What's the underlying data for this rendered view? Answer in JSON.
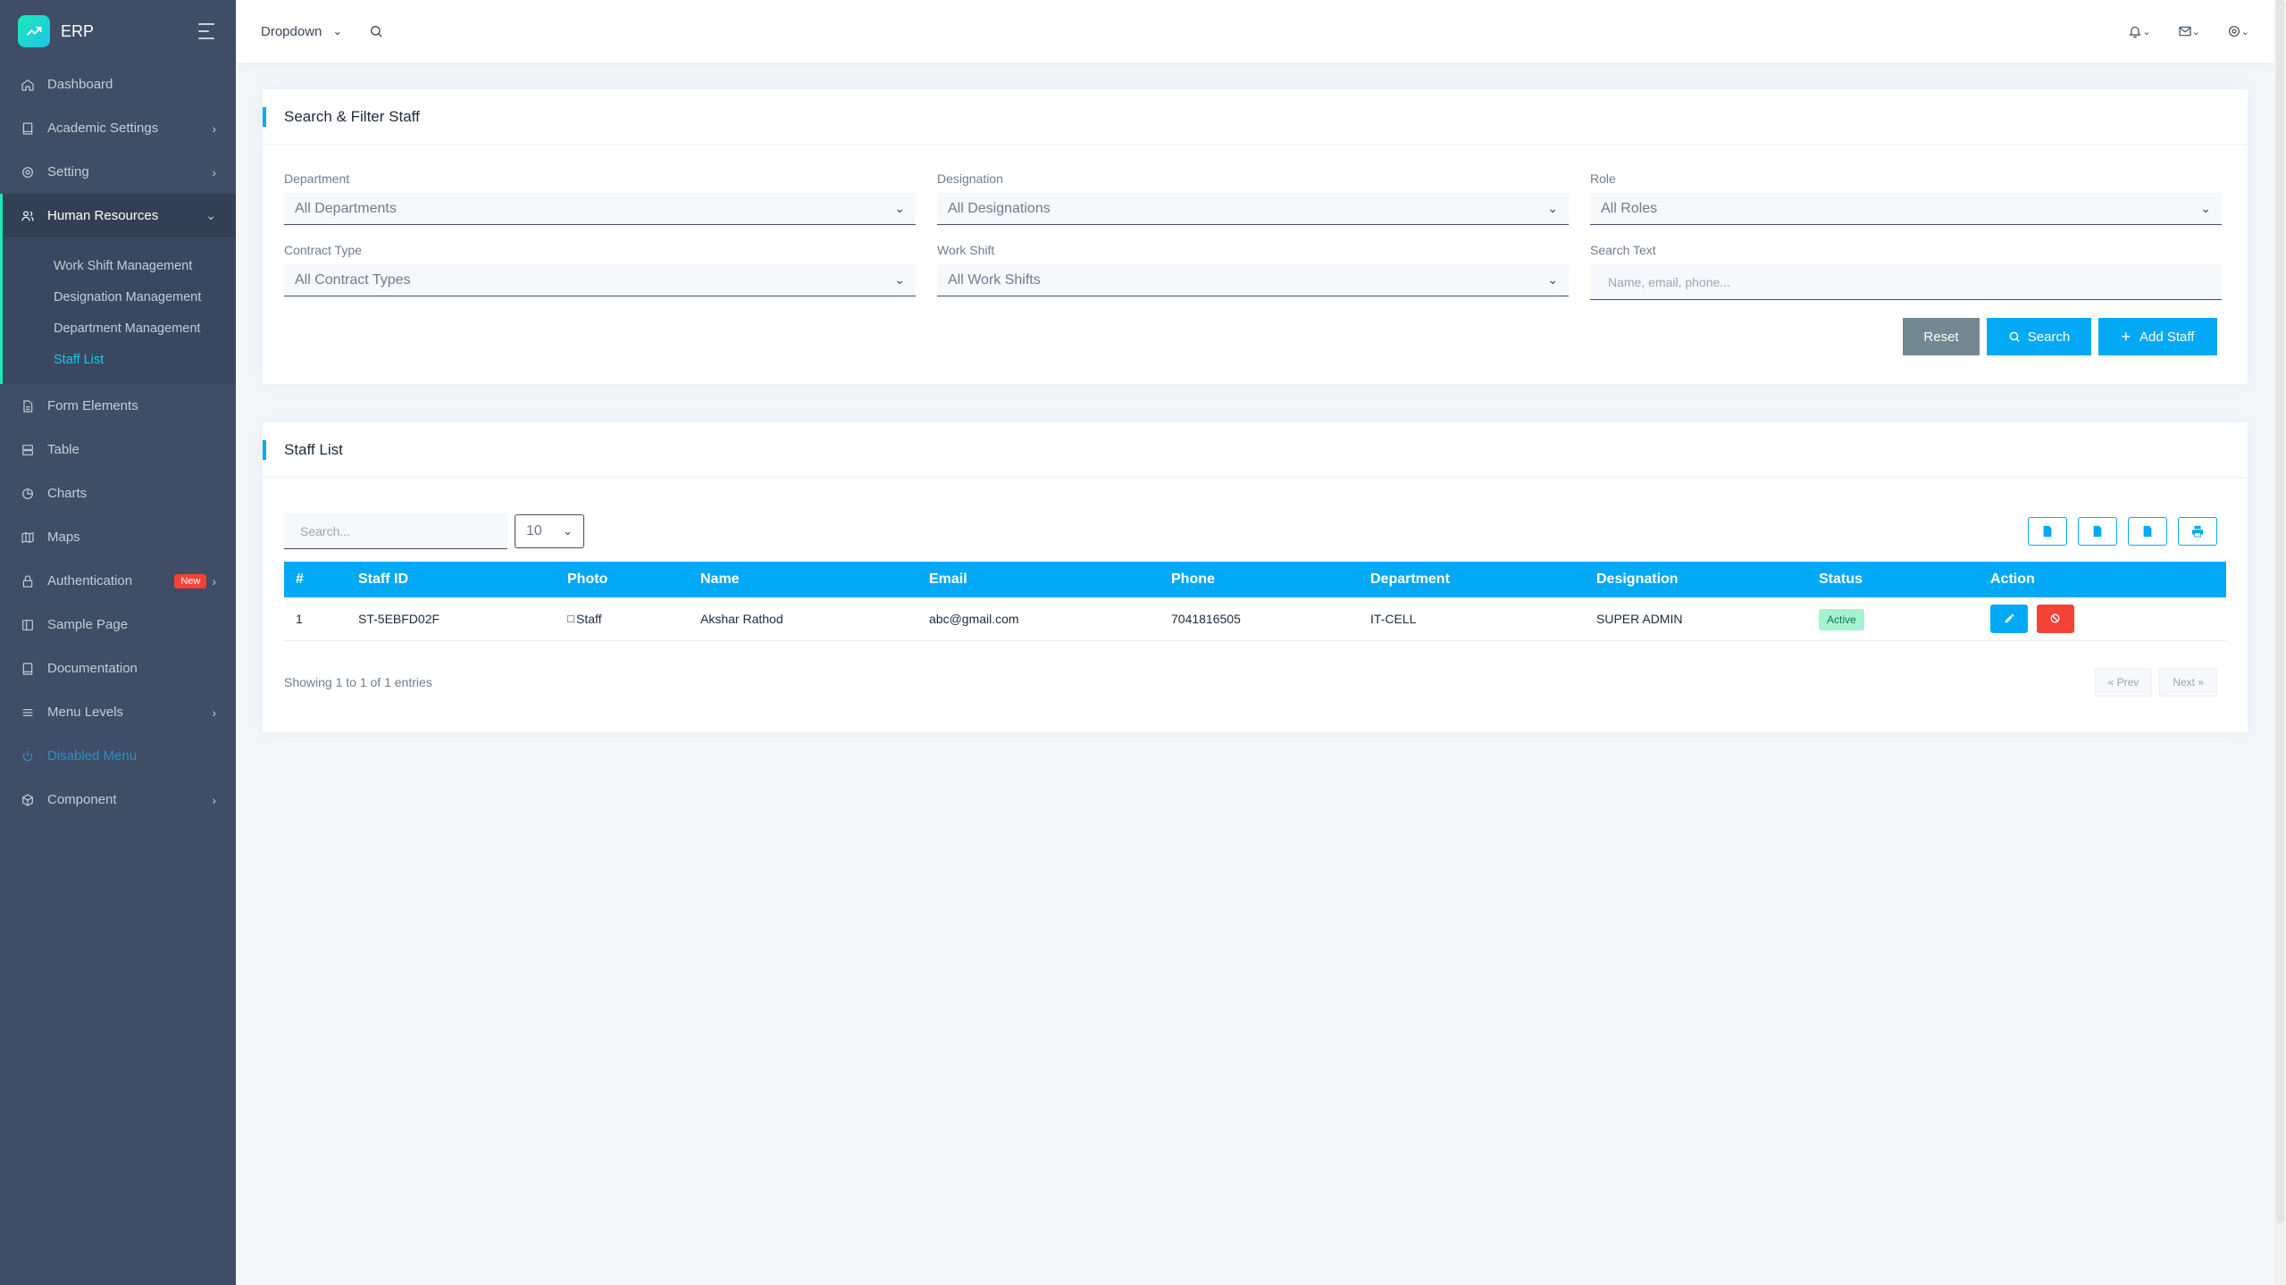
{
  "brand": {
    "name": "ERP"
  },
  "sidebar": {
    "items": [
      {
        "label": "Dashboard"
      },
      {
        "label": "Academic Settings"
      },
      {
        "label": "Setting"
      },
      {
        "label": "Human Resources"
      },
      {
        "label": "Form Elements"
      },
      {
        "label": "Table"
      },
      {
        "label": "Charts"
      },
      {
        "label": "Maps"
      },
      {
        "label": "Authentication",
        "badge": "New"
      },
      {
        "label": "Sample Page"
      },
      {
        "label": "Documentation"
      },
      {
        "label": "Menu Levels"
      },
      {
        "label": "Disabled Menu"
      },
      {
        "label": "Component"
      }
    ],
    "submenu": [
      {
        "label": "Work Shift Management"
      },
      {
        "label": "Designation Management"
      },
      {
        "label": "Department Management"
      },
      {
        "label": "Staff List"
      }
    ]
  },
  "topbar": {
    "dropdown_label": "Dropdown"
  },
  "filter": {
    "title": "Search & Filter Staff",
    "department": {
      "label": "Department",
      "value": "All Departments"
    },
    "designation": {
      "label": "Designation",
      "value": "All Designations"
    },
    "role": {
      "label": "Role",
      "value": "All Roles"
    },
    "contract_type": {
      "label": "Contract Type",
      "value": "All Contract Types"
    },
    "work_shift": {
      "label": "Work Shift",
      "value": "All Work Shifts"
    },
    "search_text": {
      "label": "Search Text",
      "placeholder": "Name, email, phone..."
    },
    "reset_label": "Reset",
    "search_label": "Search",
    "add_label": "Add Staff"
  },
  "staff_list": {
    "title": "Staff List",
    "search_placeholder": "Search...",
    "page_length": "10",
    "columns": [
      "#",
      "Staff ID",
      "Photo",
      "Name",
      "Email",
      "Phone",
      "Department",
      "Designation",
      "Status",
      "Action"
    ],
    "rows": [
      {
        "num": "1",
        "staff_id": "ST-5EBFD02F",
        "photo_alt": "Staff",
        "name": "Akshar Rathod",
        "email": "abc@gmail.com",
        "phone": "7041816505",
        "department": "IT-CELL",
        "designation": "SUPER ADMIN",
        "status": "Active"
      }
    ],
    "showing": "Showing 1 to 1 of 1 entries",
    "prev_label": "« Prev",
    "next_label": "Next »"
  },
  "colors": {
    "sidebar_bg": "#3f4d67",
    "primary": "#04a9f5",
    "danger": "#f44236",
    "success_bg": "#a7f3d0",
    "secondary": "#748892"
  }
}
